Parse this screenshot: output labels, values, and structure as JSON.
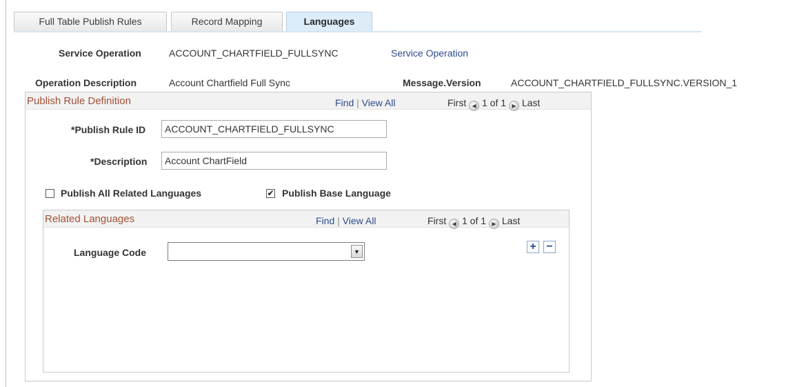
{
  "tabs": [
    {
      "label": "Full Table Publish Rules",
      "active": false
    },
    {
      "label": "Record Mapping",
      "active": false
    },
    {
      "label": "Languages",
      "active": true
    }
  ],
  "header": {
    "service_operation_label": "Service Operation",
    "service_operation_value": "ACCOUNT_CHARTFIELD_FULLSYNC",
    "service_operation_link": "Service Operation",
    "operation_description_label": "Operation Description",
    "operation_description_value": "Account Chartfield Full Sync",
    "message_version_label": "Message.Version",
    "message_version_value": "ACCOUNT_CHARTFIELD_FULLSYNC.VERSION_1"
  },
  "publish_rule": {
    "title": "Publish Rule Definition",
    "find": "Find",
    "separator": "|",
    "view_all": "View All",
    "first": "First",
    "count": "1 of 1",
    "last": "Last",
    "publish_rule_id_label": "*Publish Rule ID",
    "publish_rule_id_value": "ACCOUNT_CHARTFIELD_FULLSYNC",
    "description_label": "*Description",
    "description_value": "Account ChartField",
    "publish_all_related_label": "Publish All Related Languages",
    "publish_all_related_checked": false,
    "publish_base_label": "Publish Base Language",
    "publish_base_checked": true
  },
  "related_languages": {
    "title": "Related Languages",
    "find": "Find",
    "separator": "|",
    "view_all": "View All",
    "first": "First",
    "count": "1 of 1",
    "last": "Last",
    "language_code_label": "Language Code",
    "language_code_value": ""
  },
  "icons": {
    "prev": "arrow-left-circle-icon",
    "next": "arrow-right-circle-icon",
    "add": "plus-icon",
    "delete": "minus-icon",
    "dropdown": "chevron-down-icon"
  },
  "colors": {
    "group_title": "#a25137",
    "link": "#2c4a8a",
    "active_tab": "#dcecf8"
  }
}
